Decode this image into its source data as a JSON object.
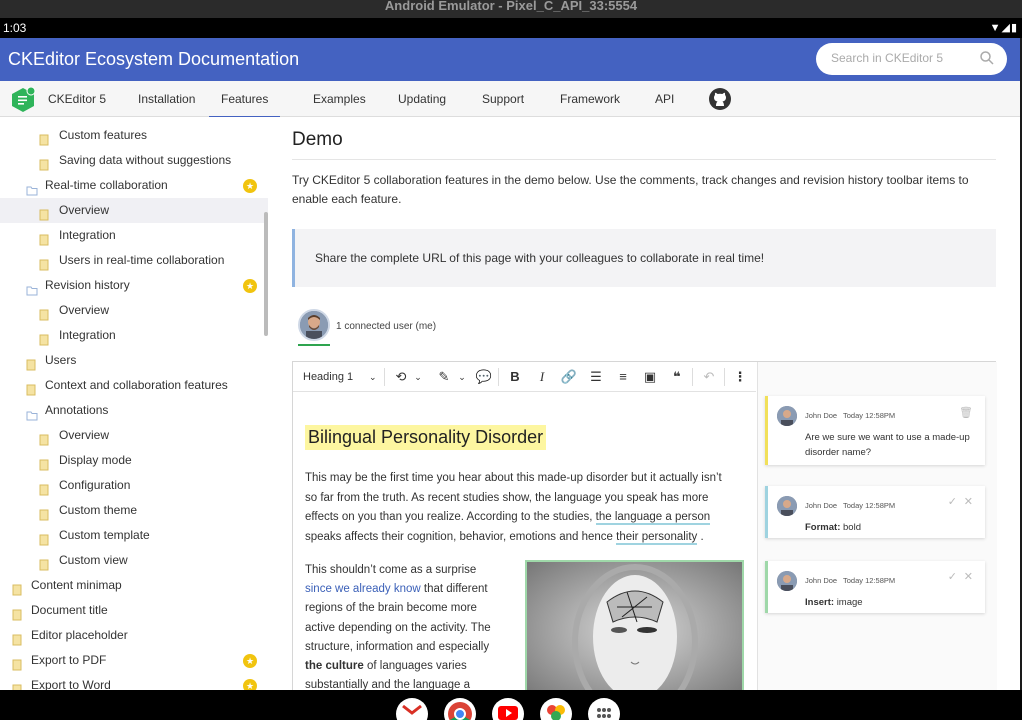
{
  "emulator": {
    "title": "Android Emulator - Pixel_C_API_33:5554"
  },
  "status_bar": {
    "time": "1:03"
  },
  "header": {
    "title": "CKEditor Ecosystem Documentation",
    "search_placeholder": "Search in CKEditor 5"
  },
  "nav": {
    "items": [
      "CKEditor 5",
      "Installation",
      "Features",
      "Examples",
      "Updating",
      "Support",
      "Framework",
      "API"
    ],
    "active": "Features",
    "logo_badge": "5"
  },
  "sidebar": {
    "items": [
      {
        "label": "Custom features"
      },
      {
        "label": "Saving data without suggestions"
      },
      {
        "label": "Real-time collaboration",
        "badge": "★"
      },
      {
        "label": "Overview"
      },
      {
        "label": "Integration"
      },
      {
        "label": "Users in real-time collaboration"
      },
      {
        "label": "Revision history",
        "badge": "★"
      },
      {
        "label": "Overview"
      },
      {
        "label": "Integration"
      },
      {
        "label": "Users"
      },
      {
        "label": "Context and collaboration features"
      },
      {
        "label": "Annotations"
      },
      {
        "label": "Overview"
      },
      {
        "label": "Display mode"
      },
      {
        "label": "Configuration"
      },
      {
        "label": "Custom theme"
      },
      {
        "label": "Custom template"
      },
      {
        "label": "Custom view"
      },
      {
        "label": "Content minimap"
      },
      {
        "label": "Document title"
      },
      {
        "label": "Editor placeholder"
      },
      {
        "label": "Export to PDF",
        "badge": "★"
      },
      {
        "label": "Export to Word",
        "badge": "★"
      }
    ]
  },
  "main": {
    "title": "Demo",
    "intro": "Try CKEditor 5 collaboration features in the demo below. Use the comments, track changes and revision history toolbar items to enable each feature.",
    "callout": "Share the complete URL of this page with your colleagues to collaborate in real time!",
    "presence": "1 connected user (me)"
  },
  "editor": {
    "heading_select": "Heading 1",
    "doc_heading": "Bilingual Personality Disorder",
    "para1_a": "This may be the first time you hear about this made-up disorder but it actually isn’t so far from the truth. As recent studies show, the language you speak has more effects on you than you realize. According to the studies, ",
    "para1_hl1": "the language a person",
    "para1_b": " speaks affects their cognition, behavior, emotions and hence ",
    "para1_hl2": "their personality",
    "para1_c": " .",
    "para2_a": "This shouldn’t come as a surprise ",
    "para2_link": "since we already know",
    "para2_b": " that different regions of the brain become more active depending on the activity. The structure, information and especially ",
    "para2_bold": "the culture",
    "para2_c": " of languages varies substantially and the language a person"
  },
  "comments": [
    {
      "author": "John Doe",
      "time": "Today 12:58PM",
      "body": "Are we sure we want to use a made-up disorder name?",
      "accent": "#f1e05a"
    },
    {
      "author": "John Doe",
      "time": "Today 12:58PM",
      "label": "Format:",
      "value": "bold",
      "accent": "#9fd3e0"
    },
    {
      "author": "John Doe",
      "time": "Today 12:58PM",
      "label": "Insert:",
      "value": "image",
      "accent": "#9fd8a9"
    }
  ],
  "colors": {
    "header": "#4462c1",
    "accent_star": "#f1c40f"
  }
}
